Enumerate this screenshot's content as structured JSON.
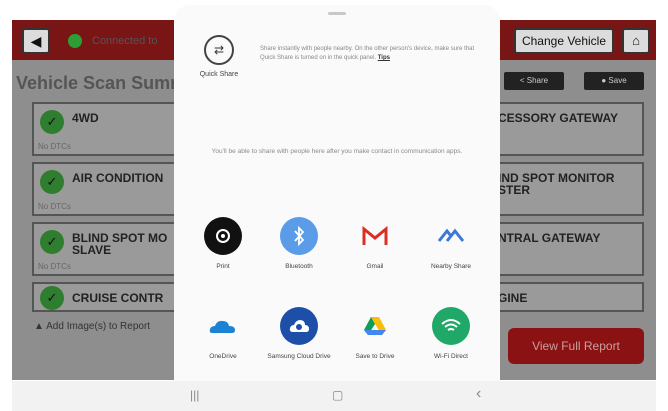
{
  "background_app": {
    "connection_text": "Connected to",
    "change_vehicle_label": "Change Vehicle",
    "summary_title": "Vehicle Scan Summ",
    "share_label": "Share",
    "save_label": "Save",
    "add_image_label": "Add Image(s) to Report",
    "view_report_label": "View Full Report",
    "left_cards": [
      {
        "name": "4WD",
        "sub": "No DTCs"
      },
      {
        "name": "AIR CONDITION",
        "sub": "No DTCs"
      },
      {
        "name": "BLIND SPOT MO\nSLAVE",
        "sub": "No DTCs"
      },
      {
        "name": "CRUISE CONTR",
        "sub": ""
      }
    ],
    "right_cards": [
      {
        "name": "CESSORY GATEWAY",
        "sub": ""
      },
      {
        "name": "IND SPOT MONITOR\nSTER",
        "sub": ""
      },
      {
        "name": "NTRAL GATEWAY",
        "sub": ""
      },
      {
        "name": "GINE",
        "sub": ""
      }
    ]
  },
  "share_sheet": {
    "quick_share_label": "Quick Share",
    "quick_share_desc": "Share instantly with people nearby. On the other person's device, make sure that Quick Share is turned on in the quick panel.",
    "tips_label": "Tips",
    "empty_message": "You'll be able to share with people here after you make contact in communication apps.",
    "apps": [
      {
        "label": "Print",
        "icon": "print-icon",
        "color": "#111111"
      },
      {
        "label": "Bluetooth",
        "icon": "bluetooth-icon",
        "color": "#5b9ce8"
      },
      {
        "label": "Gmail",
        "icon": "gmail-icon",
        "color": "#ffffff"
      },
      {
        "label": "Nearby Share",
        "icon": "nearby-share-icon",
        "color": "#ffffff"
      },
      {
        "label": "OneDrive",
        "icon": "onedrive-icon",
        "color": "#ffffff"
      },
      {
        "label": "Samsung Cloud Drive",
        "icon": "samsung-cloud-drive-icon",
        "color": "#1d4fa8"
      },
      {
        "label": "Save to Drive",
        "icon": "google-drive-icon",
        "color": "#ffffff"
      },
      {
        "label": "Wi-Fi Direct",
        "icon": "wifi-direct-icon",
        "color": "#1fa867"
      }
    ]
  },
  "nav_bar": {
    "recents_glyph": "|||",
    "home_glyph": "▢",
    "back_glyph": "‹"
  }
}
